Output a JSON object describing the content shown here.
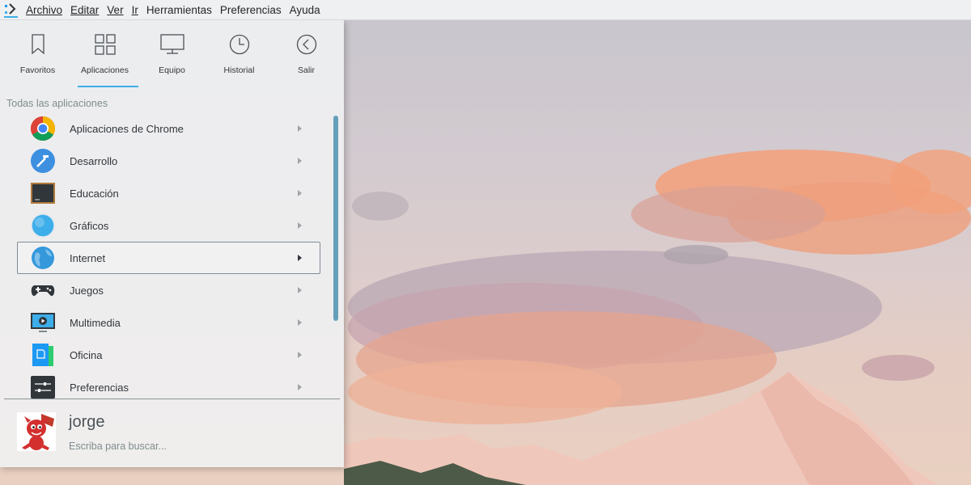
{
  "menubar": {
    "items": [
      {
        "label": "Archivo"
      },
      {
        "label": "Editar"
      },
      {
        "label": "Ver"
      },
      {
        "label": "Ir"
      },
      {
        "label": "Herramientas"
      },
      {
        "label": "Preferencias"
      },
      {
        "label": "Ayuda"
      }
    ]
  },
  "launcher": {
    "tabs": [
      {
        "label": "Favoritos",
        "icon": "bookmark-icon"
      },
      {
        "label": "Aplicaciones",
        "icon": "grid-icon",
        "active": true
      },
      {
        "label": "Equipo",
        "icon": "monitor-icon"
      },
      {
        "label": "Historial",
        "icon": "clock-icon"
      },
      {
        "label": "Salir",
        "icon": "leave-icon"
      }
    ],
    "section_title": "Todas las aplicaciones",
    "apps": [
      {
        "label": "Aplicaciones de Chrome",
        "icon": "chrome-icon"
      },
      {
        "label": "Desarrollo",
        "icon": "development-icon"
      },
      {
        "label": "Educación",
        "icon": "education-icon"
      },
      {
        "label": "Gráficos",
        "icon": "graphics-icon"
      },
      {
        "label": "Internet",
        "icon": "internet-icon",
        "selected": true
      },
      {
        "label": "Juegos",
        "icon": "gamepad-icon"
      },
      {
        "label": "Multimedia",
        "icon": "multimedia-icon"
      },
      {
        "label": "Oficina",
        "icon": "office-icon"
      },
      {
        "label": "Preferencias",
        "icon": "settings-icon"
      }
    ],
    "user": {
      "name": "jorge"
    },
    "search": {
      "placeholder": "Escriba para buscar..."
    }
  },
  "colors": {
    "accent": "#3daee9",
    "scrollbar": "#64a0ba",
    "text": "#31363b"
  }
}
